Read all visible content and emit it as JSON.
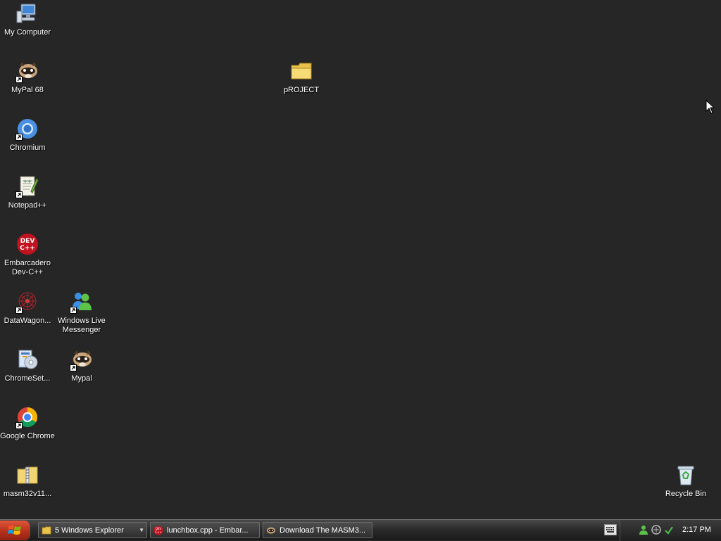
{
  "desktop": {
    "icons": [
      {
        "label": "My Computer",
        "icon": "computer-icon"
      },
      {
        "label": "MyPal 68",
        "icon": "mypal-icon"
      },
      {
        "label": "Chromium",
        "icon": "chromium-icon"
      },
      {
        "label": "Notepad++",
        "icon": "notepadpp-icon"
      },
      {
        "label": "Embarcadero\nDev-C++",
        "icon": "devcpp-icon"
      },
      {
        "label": "DataWagon...",
        "icon": "datawagon-icon"
      },
      {
        "label": "ChromeSet...",
        "icon": "installer-icon"
      },
      {
        "label": "Google Chrome",
        "icon": "chrome-icon"
      },
      {
        "label": "masm32v11...",
        "icon": "zip-folder-icon"
      },
      {
        "label": "Windows Live\nMessenger",
        "icon": "messenger-icon"
      },
      {
        "label": "Mypal",
        "icon": "mypal-icon"
      },
      {
        "label": "pROJECT",
        "icon": "folder-icon"
      },
      {
        "label": "Recycle Bin",
        "icon": "recycle-bin-icon"
      }
    ]
  },
  "taskbar": {
    "tasks": [
      {
        "label": "5 Windows Explorer",
        "icon": "folder-icon"
      },
      {
        "label": "lunchbox.cpp - Embar...",
        "icon": "devcpp-icon"
      },
      {
        "label": "Download The MASM3...",
        "icon": "mypal-icon"
      }
    ],
    "clock": "2:17 PM",
    "tray": [
      "keyboard-icon",
      "messenger-status-icon",
      "network-icon",
      "sync-icon"
    ]
  },
  "colors": {
    "desktop_background": "#262626",
    "start_button": "#c23a21"
  }
}
